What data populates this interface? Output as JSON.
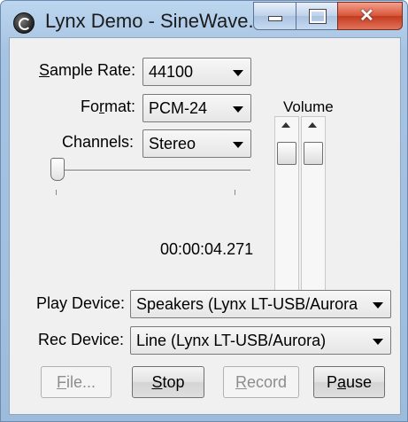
{
  "window": {
    "title": "Lynx Demo - SineWave..."
  },
  "caption": {
    "minimize": "",
    "maximize": "",
    "close": "✕"
  },
  "sample_rate": {
    "label_u": "S",
    "label_rest": "ample Rate:",
    "value": "44100"
  },
  "format": {
    "label_pre": "Fo",
    "label_u": "r",
    "label_rest": "mat:",
    "value": "PCM-24"
  },
  "channels": {
    "label": "Channels:",
    "value": "Stereo"
  },
  "position": {
    "time": "00:00:04.271",
    "fraction": 0.0
  },
  "volume": {
    "label": "Volume",
    "left_level": 1.0,
    "right_level": 1.0
  },
  "play_device": {
    "label": "Play Device:",
    "value": "Speakers (Lynx LT-USB/Aurora"
  },
  "rec_device": {
    "label": "Rec Device:",
    "value": "Line (Lynx LT-USB/Aurora)"
  },
  "buttons": {
    "file_u": "F",
    "file_rest": "ile...",
    "stop_u": "S",
    "stop_rest": "top",
    "record_u": "R",
    "record_rest": "ecord",
    "pause_pre": "P",
    "pause_u": "a",
    "pause_rest": "use"
  }
}
